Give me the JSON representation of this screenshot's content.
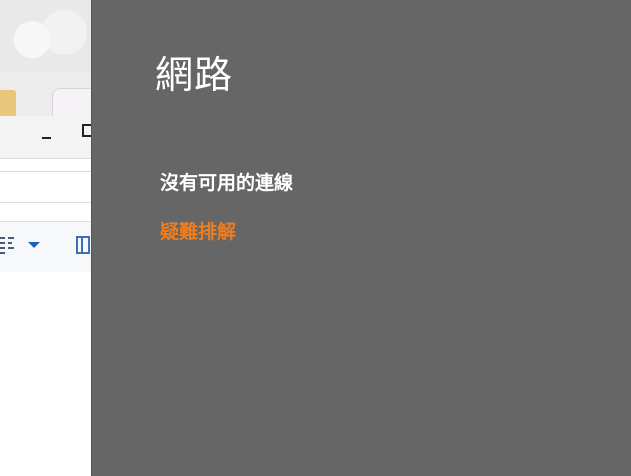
{
  "network_flyout": {
    "title": "網路",
    "status_text": "沒有可用的連線",
    "troubleshoot_link": "疑難排解",
    "colors": {
      "background": "#666666",
      "text": "#ffffff",
      "link": "#f07c1e"
    }
  },
  "background_window": {
    "icons": [
      "folder-icon",
      "minimize-icon",
      "maximize-icon",
      "list-view-icon",
      "dropdown-arrow-icon",
      "panel-layout-icon"
    ]
  }
}
